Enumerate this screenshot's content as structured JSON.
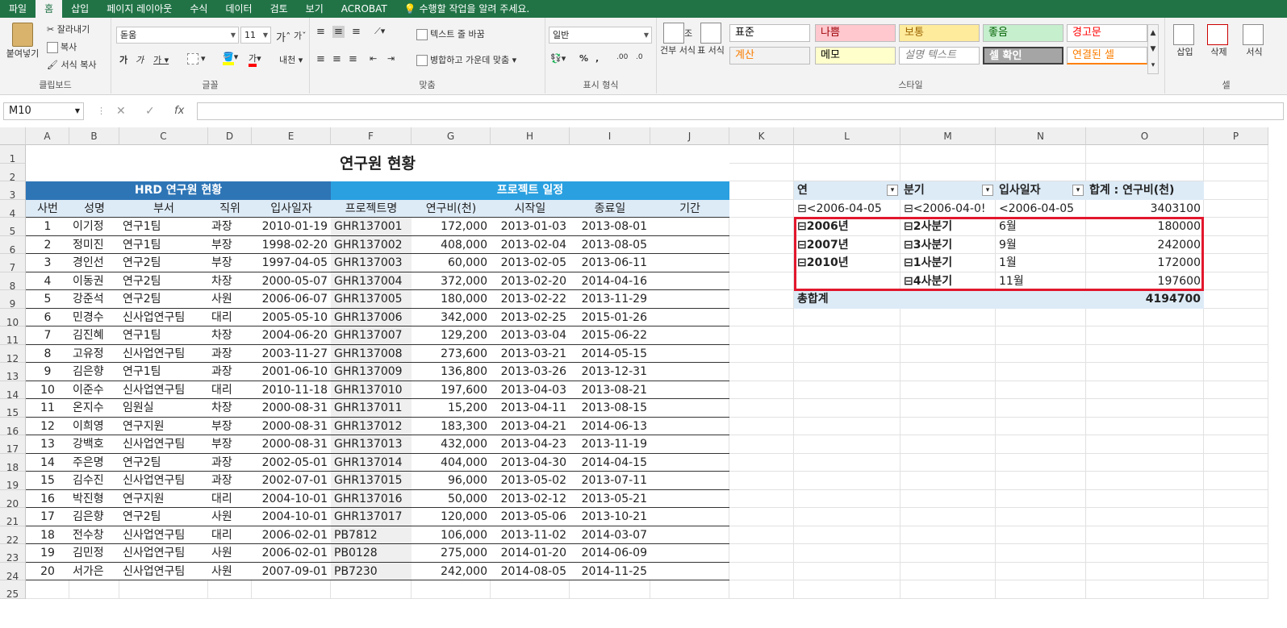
{
  "tabs": [
    "파일",
    "홈",
    "삽입",
    "페이지 레이아웃",
    "수식",
    "데이터",
    "검토",
    "보기",
    "ACROBAT"
  ],
  "tell_me": "수행할 작업을 알려 주세요.",
  "clipboard": {
    "paste": "붙여넣기",
    "cut": "잘라내기",
    "copy": "복사",
    "format_painter": "서식 복사",
    "label": "클립보드"
  },
  "font": {
    "name": "돋움",
    "size": "11",
    "label": "글꼴"
  },
  "align": {
    "wrap": "텍스트 줄 바꿈",
    "merge": "병합하고 가운데 맞춤",
    "label": "맞춤"
  },
  "number": {
    "format": "일반",
    "label": "표시 형식"
  },
  "styles": {
    "cond": "조건부 서식",
    "table": "표 서식",
    "label": "스타일",
    "cells": [
      {
        "t": "표준",
        "bg": "#ffffff",
        "fg": "#000000"
      },
      {
        "t": "나쁨",
        "bg": "#ffc7ce",
        "fg": "#9c0006"
      },
      {
        "t": "보통",
        "bg": "#ffeb9c",
        "fg": "#9c6500"
      },
      {
        "t": "좋음",
        "bg": "#c6efce",
        "fg": "#006100"
      },
      {
        "t": "경고문",
        "bg": "#ffffff",
        "fg": "#ff0000"
      },
      {
        "t": "계산",
        "bg": "#f2f2f2",
        "fg": "#fa7d00"
      },
      {
        "t": "메모",
        "bg": "#ffffcc",
        "fg": "#000000"
      },
      {
        "t": "설명 텍스트",
        "bg": "#ffffff",
        "fg": "#7f7f7f"
      },
      {
        "t": "셀 확인",
        "bg": "#a5a5a5",
        "fg": "#ffffff"
      },
      {
        "t": "연결된 셀",
        "bg": "#ffffff",
        "fg": "#fa7d00"
      }
    ]
  },
  "cells_group": {
    "insert": "삽입",
    "delete": "삭제",
    "format": "서식",
    "label": "셀"
  },
  "formula_bar": {
    "name_box": "M10",
    "fx": "fx",
    "formula": ""
  },
  "columns": [
    "A",
    "B",
    "C",
    "D",
    "E",
    "F",
    "G",
    "H",
    "I",
    "J",
    "K",
    "L",
    "M",
    "N",
    "O",
    "P"
  ],
  "rows": [
    "1",
    "2",
    "3",
    "4",
    "5",
    "6",
    "7",
    "8",
    "9",
    "10",
    "11",
    "12",
    "13",
    "14",
    "15",
    "16",
    "17",
    "18",
    "19",
    "20",
    "21",
    "22",
    "23",
    "24",
    "25"
  ],
  "title": "연구원 현황",
  "hrd_header": "HRD 연구원 현황",
  "project_header": "프로젝트 일정",
  "table_headers": [
    "사번",
    "성명",
    "부서",
    "직위",
    "입사일자",
    "프로젝트명",
    "연구비(천)",
    "시작일",
    "종료일",
    "기간"
  ],
  "table_rows": [
    [
      "1",
      "이기정",
      "연구1팀",
      "과장",
      "2010-01-19",
      "GHR137001",
      "172,000",
      "2013-01-03",
      "2013-08-01"
    ],
    [
      "2",
      "정미진",
      "연구1팀",
      "부장",
      "1998-02-20",
      "GHR137002",
      "408,000",
      "2013-02-04",
      "2013-08-05"
    ],
    [
      "3",
      "경인선",
      "연구2팀",
      "부장",
      "1997-04-05",
      "GHR137003",
      "60,000",
      "2013-02-05",
      "2013-06-11"
    ],
    [
      "4",
      "이동권",
      "연구2팀",
      "차장",
      "2000-05-07",
      "GHR137004",
      "372,000",
      "2013-02-20",
      "2014-04-16"
    ],
    [
      "5",
      "강준석",
      "연구2팀",
      "사원",
      "2006-06-07",
      "GHR137005",
      "180,000",
      "2013-02-22",
      "2013-11-29"
    ],
    [
      "6",
      "민경수",
      "신사업연구팀",
      "대리",
      "2005-05-10",
      "GHR137006",
      "342,000",
      "2013-02-25",
      "2015-01-26"
    ],
    [
      "7",
      "김진혜",
      "연구1팀",
      "차장",
      "2004-06-20",
      "GHR137007",
      "129,200",
      "2013-03-04",
      "2015-06-22"
    ],
    [
      "8",
      "고유정",
      "신사업연구팀",
      "과장",
      "2003-11-27",
      "GHR137008",
      "273,600",
      "2013-03-21",
      "2014-05-15"
    ],
    [
      "9",
      "김은향",
      "연구1팀",
      "과장",
      "2001-06-10",
      "GHR137009",
      "136,800",
      "2013-03-26",
      "2013-12-31"
    ],
    [
      "10",
      "이준수",
      "신사업연구팀",
      "대리",
      "2010-11-18",
      "GHR137010",
      "197,600",
      "2013-04-03",
      "2013-08-21"
    ],
    [
      "11",
      "온지수",
      "임원실",
      "차장",
      "2000-08-31",
      "GHR137011",
      "15,200",
      "2013-04-11",
      "2013-08-15"
    ],
    [
      "12",
      "이희영",
      "연구지원",
      "부장",
      "2000-08-31",
      "GHR137012",
      "183,300",
      "2013-04-21",
      "2014-06-13"
    ],
    [
      "13",
      "강백호",
      "신사업연구팀",
      "부장",
      "2000-08-31",
      "GHR137013",
      "432,000",
      "2013-04-23",
      "2013-11-19"
    ],
    [
      "14",
      "주은명",
      "연구2팀",
      "과장",
      "2002-05-01",
      "GHR137014",
      "404,000",
      "2013-04-30",
      "2014-04-15"
    ],
    [
      "15",
      "김수진",
      "신사업연구팀",
      "과장",
      "2002-07-01",
      "GHR137015",
      "96,000",
      "2013-05-02",
      "2013-07-11"
    ],
    [
      "16",
      "박진형",
      "연구지원",
      "대리",
      "2004-10-01",
      "GHR137016",
      "50,000",
      "2013-02-12",
      "2013-05-21"
    ],
    [
      "17",
      "김은향",
      "연구2팀",
      "사원",
      "2004-10-01",
      "GHR137017",
      "120,000",
      "2013-05-06",
      "2013-10-21"
    ],
    [
      "18",
      "전수창",
      "신사업연구팀",
      "대리",
      "2006-02-01",
      "PB7812",
      "106,000",
      "2013-11-02",
      "2014-03-07"
    ],
    [
      "19",
      "김민정",
      "신사업연구팀",
      "사원",
      "2006-02-01",
      "PB0128",
      "275,000",
      "2014-01-20",
      "2014-06-09"
    ],
    [
      "20",
      "서가은",
      "신사업연구팀",
      "사원",
      "2007-09-01",
      "PB7230",
      "242,000",
      "2014-08-05",
      "2014-11-25"
    ]
  ],
  "pivot": {
    "headers": [
      "연",
      "분기",
      "입사일자",
      "합계 : 연구비(천)"
    ],
    "rows": [
      {
        "year": "<2006-04-05",
        "q": "<2006-04-0!",
        "m": "<2006-04-05",
        "v": "3403100"
      },
      {
        "year": "2006년",
        "q": "2사분기",
        "m": "6월",
        "v": "180000"
      },
      {
        "year": "2007년",
        "q": "3사분기",
        "m": "9월",
        "v": "242000"
      },
      {
        "year": "2010년",
        "q": "1사분기",
        "m": "1월",
        "v": "172000"
      },
      {
        "year": "",
        "q": "4사분기",
        "m": "11월",
        "v": "197600"
      }
    ],
    "total_label": "총합계",
    "total": "4194700"
  },
  "colors": {
    "ribbon_green": "#217346",
    "hrd_blue": "#2e75b6",
    "project_blue": "#2aa0e0",
    "header_light": "#ddebf7",
    "pivot_header": "#ddebf7",
    "highlight_red": "#e2172d"
  }
}
